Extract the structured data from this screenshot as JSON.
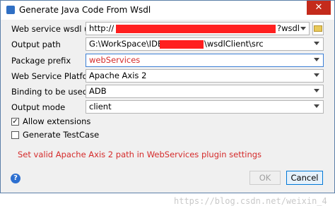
{
  "window": {
    "title": "Generate Java Code From Wsdl"
  },
  "form": {
    "wsdl_url": {
      "label": "Web service wsdl url",
      "value_prefix": "http://",
      "value_suffix": "?wsdl"
    },
    "output_path": {
      "label": "Output path",
      "value_prefix": "G:\\WorkSpace\\IDEA\\",
      "value_suffix": "\\wsdlClient\\src"
    },
    "package_prefix": {
      "label": "Package prefix",
      "value": "webServices"
    },
    "platform": {
      "label": "Web Service Platform",
      "value": "Apache Axis 2"
    },
    "binding": {
      "label": "Binding to be used",
      "value": "ADB"
    },
    "output_mode": {
      "label": "Output mode",
      "value": "client"
    }
  },
  "options": {
    "allow_extensions": {
      "label": "Allow extensions",
      "checked": true,
      "mark": "✓"
    },
    "generate_testcase": {
      "label": "Generate TestCase",
      "checked": false
    }
  },
  "warning": "Set valid Apache Axis 2 path in WebServices plugin settings",
  "buttons": {
    "help": "?",
    "ok": "OK",
    "cancel": "Cancel",
    "close": "✕"
  },
  "watermark": "https://blog.csdn.net/weixin_4"
}
